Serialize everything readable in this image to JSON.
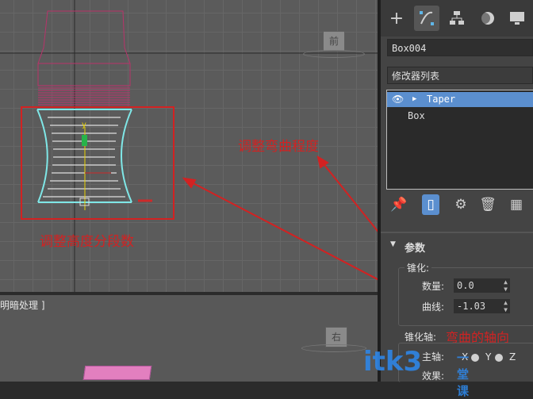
{
  "viewport_top": {
    "view_cube_label": "前"
  },
  "viewport_bottom": {
    "label": "明暗处理 ]",
    "view_cube_label": "右"
  },
  "panel": {
    "tabs": [
      {
        "icon": "plus-icon",
        "label": "+"
      },
      {
        "icon": "modify-icon",
        "label": "⌗"
      },
      {
        "icon": "hierarchy-icon",
        "label": "⊞"
      },
      {
        "icon": "motion-icon",
        "label": "●"
      },
      {
        "icon": "display-icon",
        "label": "▭"
      }
    ],
    "object_name": "Box004",
    "modifier_list": "修改器列表",
    "stack": [
      {
        "label": "Taper",
        "selected": true
      },
      {
        "label": "Box",
        "selected": false
      }
    ],
    "section_title": "参数",
    "taper_group": "锥化:",
    "amount_label": "数量:",
    "amount_value": "0.0",
    "curve_label": "曲线:",
    "curve_value": "-1.03",
    "taper_axis_label": "锥化轴:",
    "primary_label": "主轴:",
    "effect_label": "效果:",
    "axis_x": "X",
    "axis_y": "Y",
    "axis_z": "Z"
  },
  "annotations": {
    "adjust_height_segments": "调整高度分段数",
    "adjust_curvature": "调整弯曲程度",
    "bend_axis": "弯曲的轴向"
  },
  "watermark": {
    "brand": "itk3",
    "sub": "一堂课"
  },
  "colors": {
    "viewport_bg": "#5b5b5b",
    "panel_bg": "#444444",
    "selection_blue": "#5b8fcf",
    "annotation_red": "#d22222",
    "wireframe_cyan": "#7fe7e7",
    "wireframe_magenta": "#c0306c"
  }
}
